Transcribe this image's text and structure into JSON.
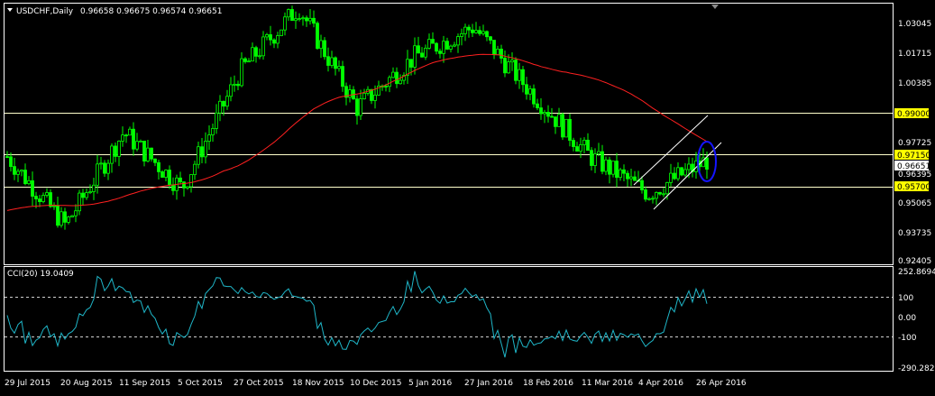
{
  "header": {
    "symbol": "USDCHF,Daily",
    "ohlc": "0.96658 0.96675 0.96574 0.96651"
  },
  "indicator": {
    "label": "CCI(20) 19.0409"
  },
  "colors": {
    "background": "#000000",
    "candles": "#00ff00",
    "moving_average": "#ff0000",
    "horizontal_lines": "#ffffcc",
    "channel_lines": "#ffffff",
    "ellipse": "#0000ff",
    "cci_line": "#1fb6c8",
    "tag_bg": "#ffff00",
    "current_price_bg": "#ffffff"
  },
  "price_axis": {
    "ticks": [
      "1.03045",
      "1.01715",
      "1.00385",
      "0.97725",
      "0.95065",
      "0.93735",
      "0.92405"
    ],
    "tags": [
      {
        "value": "0.99000",
        "style": "yellow"
      },
      {
        "value": "0.97150",
        "style": "yellow"
      },
      {
        "value": "0.96651",
        "style": "current"
      },
      {
        "value": "0.96395",
        "style": "plain"
      },
      {
        "value": "0.95700",
        "style": "yellow"
      }
    ]
  },
  "cci_axis": {
    "ticks": [
      "252.8694",
      "100",
      "0.00",
      "-100",
      "-290.2825"
    ]
  },
  "time_axis": {
    "labels": [
      "29 Jul 2015",
      "20 Aug 2015",
      "11 Sep 2015",
      "5 Oct 2015",
      "27 Oct 2015",
      "18 Nov 2015",
      "10 Dec 2015",
      "5 Jan 2016",
      "27 Jan 2016",
      "18 Feb 2016",
      "11 Mar 2016",
      "4 Apr 2016",
      "26 Apr 2016"
    ]
  },
  "chart_data": {
    "type": "line",
    "title": "USDCHF,Daily",
    "x": [
      "29 Jul 2015",
      "20 Aug 2015",
      "11 Sep 2015",
      "5 Oct 2015",
      "27 Oct 2015",
      "18 Nov 2015",
      "10 Dec 2015",
      "5 Jan 2016",
      "27 Jan 2016",
      "18 Feb 2016",
      "11 Mar 2016",
      "4 Apr 2016",
      "26 Apr 2016"
    ],
    "series": [
      {
        "values": [
          0.968,
          0.94,
          0.978,
          0.955,
          1.003,
          1.029,
          0.988,
          1.009,
          1.021,
          0.994,
          0.968,
          0.953,
          0.9665
        ]
      }
    ],
    "ylim": [
      0.92405,
      1.03045
    ],
    "hlines": [
      0.99,
      0.9715,
      0.957
    ],
    "indicator": {
      "name": "CCI(20)",
      "last": 19.0409,
      "ylim": [
        -290.2825,
        252.8694
      ]
    }
  }
}
